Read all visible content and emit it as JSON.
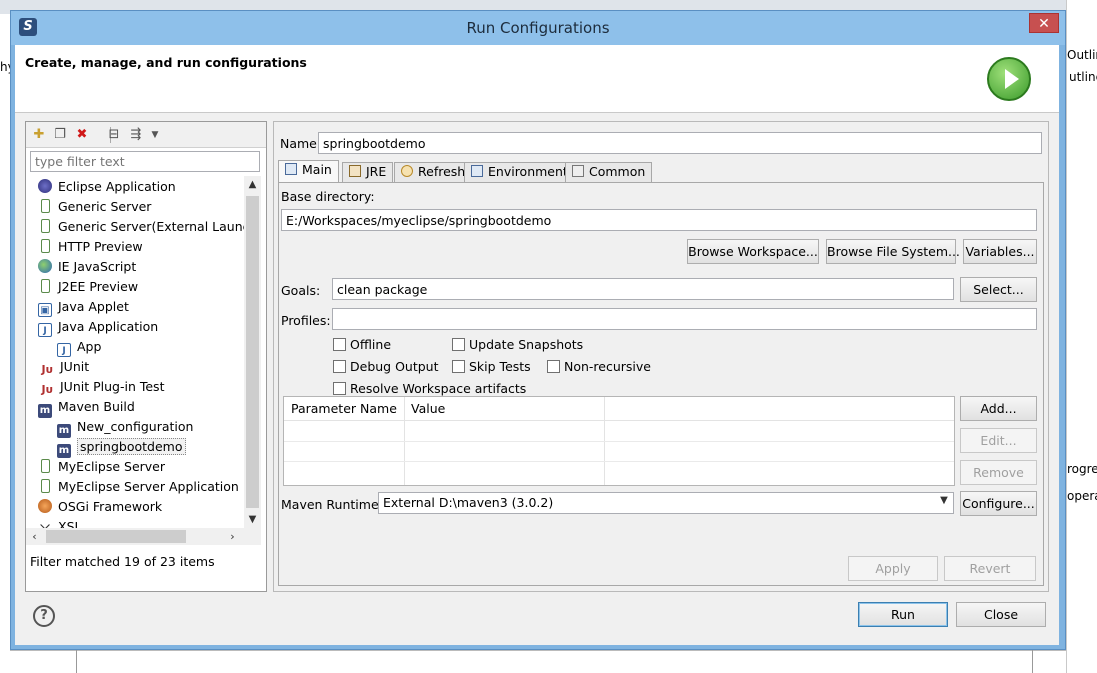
{
  "background": {
    "left_fragment": "hy",
    "right_top_a": "Outline",
    "right_top_b": "utline",
    "right_mid_a": "rogre",
    "right_mid_b": "opera"
  },
  "window": {
    "title": "Run Configurations",
    "close_glyph": "✕"
  },
  "banner": {
    "title": "Create, manage, and run configurations"
  },
  "left_panel": {
    "toolbar": {
      "new_icon": "new-config-icon",
      "duplicate_icon": "duplicate-icon",
      "delete_icon": "delete-icon",
      "collapse_icon": "collapse-all-icon",
      "filter_icon": "filter-icon"
    },
    "filter_placeholder": "type filter text",
    "tree": [
      {
        "label": "Eclipse Application",
        "icon": "eclipse-icon",
        "indent": 0
      },
      {
        "label": "Generic Server",
        "icon": "server-icon",
        "indent": 0
      },
      {
        "label": "Generic Server(External Launch)",
        "icon": "server-icon",
        "indent": 0
      },
      {
        "label": "HTTP Preview",
        "icon": "server-icon",
        "indent": 0
      },
      {
        "label": "IE JavaScript",
        "icon": "globe-icon",
        "indent": 0
      },
      {
        "label": "J2EE Preview",
        "icon": "server-icon",
        "indent": 0
      },
      {
        "label": "Java Applet",
        "icon": "applet-icon",
        "indent": 0
      },
      {
        "label": "Java Application",
        "icon": "java-icon",
        "indent": 0
      },
      {
        "label": "App",
        "icon": "java-icon",
        "indent": 1
      },
      {
        "label": "JUnit",
        "icon": "junit-icon",
        "indent": 0
      },
      {
        "label": "JUnit Plug-in Test",
        "icon": "junit-icon",
        "indent": 0
      },
      {
        "label": "Maven Build",
        "icon": "maven-icon",
        "indent": 0
      },
      {
        "label": "New_configuration",
        "icon": "maven-icon",
        "indent": 1
      },
      {
        "label": "springbootdemo",
        "icon": "maven-icon",
        "indent": 1,
        "selected": true
      },
      {
        "label": "MyEclipse Server",
        "icon": "server-icon",
        "indent": 0
      },
      {
        "label": "MyEclipse Server Application",
        "icon": "server-icon",
        "indent": 0
      },
      {
        "label": "OSGi Framework",
        "icon": "osgi-icon",
        "indent": 0
      },
      {
        "label": "XSL",
        "icon": "xsl-icon",
        "indent": 0
      }
    ],
    "filter_status": "Filter matched 19 of 23 items"
  },
  "right_panel": {
    "name_label": "Name:",
    "name_value": "springbootdemo",
    "tabs": [
      {
        "label": "Main",
        "active": true
      },
      {
        "label": "JRE",
        "active": false
      },
      {
        "label": "Refresh",
        "active": false
      },
      {
        "label": "Environment",
        "active": false
      },
      {
        "label": "Common",
        "active": false
      }
    ],
    "main": {
      "base_directory_label": "Base directory:",
      "base_directory_value": "E:/Workspaces/myeclipse/springbootdemo",
      "browse_workspace": "Browse Workspace...",
      "browse_file_system": "Browse File System...",
      "variables": "Variables...",
      "goals_label": "Goals:",
      "goals_value": "clean package",
      "select_button": "Select...",
      "profiles_label": "Profiles:",
      "profiles_value": "",
      "checkboxes": {
        "offline": "Offline",
        "update_snapshots": "Update Snapshots",
        "debug_output": "Debug Output",
        "skip_tests": "Skip Tests",
        "non_recursive": "Non-recursive",
        "resolve_workspace": "Resolve Workspace artifacts"
      },
      "param_table": {
        "col_name": "Parameter Name",
        "col_value": "Value"
      },
      "add_button": "Add...",
      "edit_button": "Edit...",
      "remove_button": "Remove",
      "maven_runtime_label": "Maven Runtime:",
      "maven_runtime_value": "External D:\\maven3 (3.0.2)",
      "configure_button": "Configure..."
    },
    "apply_button": "Apply",
    "revert_button": "Revert"
  },
  "footer": {
    "help_glyph": "?",
    "run_button": "Run",
    "close_button": "Close"
  }
}
